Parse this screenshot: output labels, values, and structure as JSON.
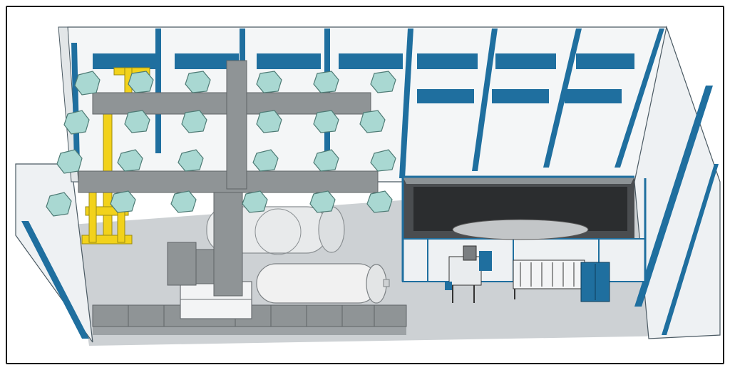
{
  "scene": {
    "frame_color": "#1a1a1a",
    "wall_color": "#f4f6f7",
    "wall_shadow_color": "#e2e6e8",
    "floor_color": "#c9cdd0",
    "column_color": "#1f6f9f",
    "window_color": "#1f6f9f",
    "duct_color": "#8f9496",
    "hood_color": "#a9d8d2",
    "crane_color": "#f2d21b",
    "booth_frame_color": "#1f6f9f",
    "tank_color": "#f1f1f1",
    "panel_color": "#1f6f9f"
  },
  "components": [
    {
      "id": "left-wall-panel",
      "icon": "wall"
    },
    {
      "id": "back-wall-panel",
      "icon": "wall"
    },
    {
      "id": "right-wall-panel",
      "icon": "wall"
    },
    {
      "id": "yellow-gantry-crane",
      "icon": "crane"
    },
    {
      "id": "suction-hood-array-upper",
      "icon": "hood"
    },
    {
      "id": "suction-hood-array-lower",
      "icon": "hood"
    },
    {
      "id": "air-duct-network",
      "icon": "duct"
    },
    {
      "id": "large-pressure-tank",
      "icon": "tank"
    },
    {
      "id": "horizontal-storage-tank",
      "icon": "tank"
    },
    {
      "id": "filter-unit-stack",
      "icon": "filter"
    },
    {
      "id": "paint-booth-enclosure",
      "icon": "booth"
    },
    {
      "id": "work-platform-with-ladder",
      "icon": "platform"
    },
    {
      "id": "drying-rack-cart",
      "icon": "rack"
    },
    {
      "id": "control-cabinet",
      "icon": "cabinet"
    },
    {
      "id": "floor-duct-run",
      "icon": "duct"
    }
  ]
}
